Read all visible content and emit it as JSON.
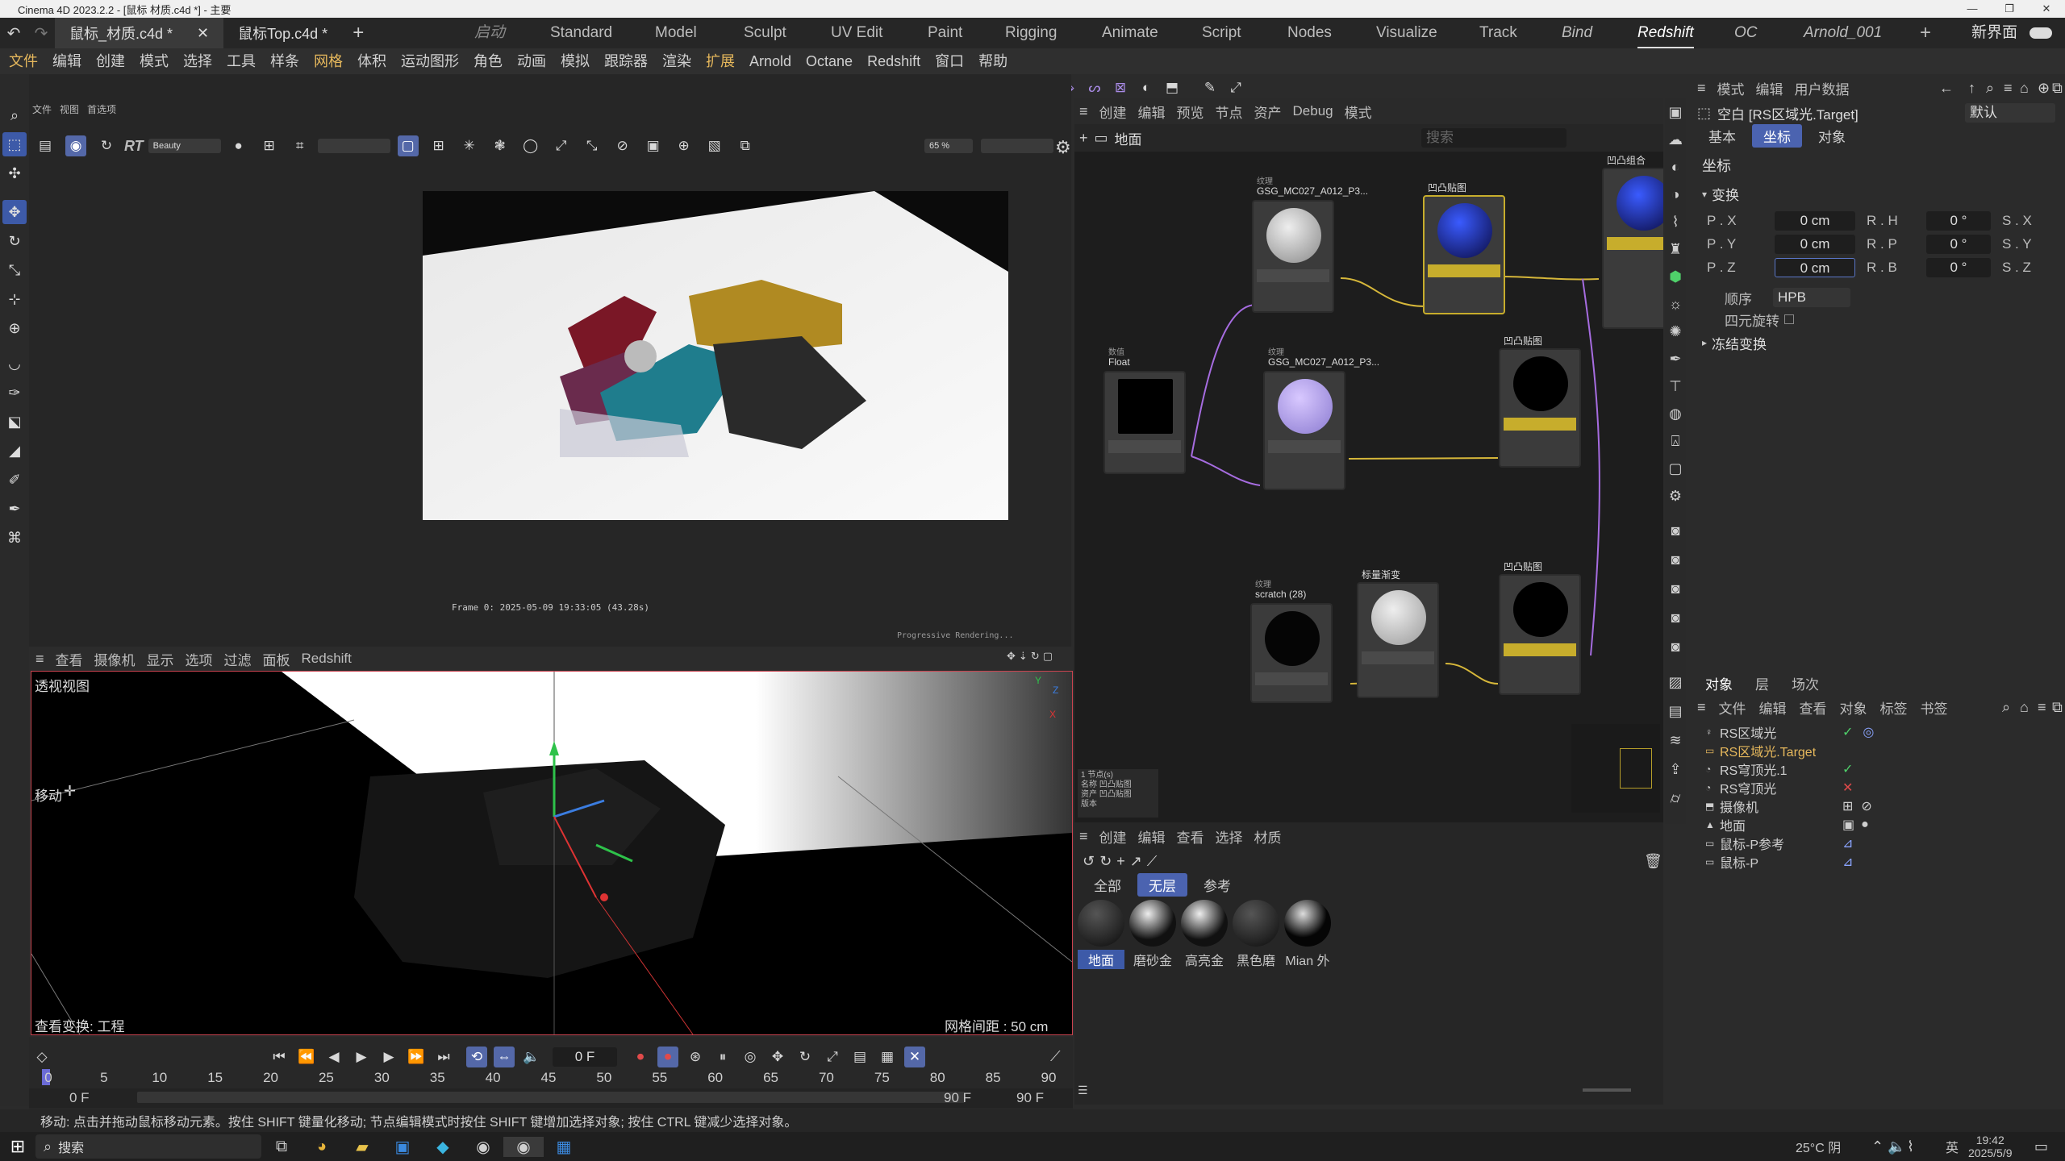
{
  "title": {
    "text": "Cinema 4D 2023.2.2 - [鼠标 材质.c4d *] - 主要"
  },
  "tabs": [
    {
      "label": "鼠标_材质.c4d *"
    },
    {
      "label": "鼠标Top.c4d *"
    }
  ],
  "layouts": [
    "启动",
    "Standard",
    "Model",
    "Sculpt",
    "UV Edit",
    "Paint",
    "Rigging",
    "Animate",
    "Script",
    "Nodes",
    "Visualize",
    "Track",
    "Bind",
    "Redshift",
    "OC",
    "Arnold_001"
  ],
  "new_layout": "新界面",
  "menu": [
    "文件",
    "编辑",
    "创建",
    "模式",
    "选择",
    "工具",
    "样条",
    "网格",
    "体积",
    "运动图形",
    "角色",
    "动画",
    "模拟",
    "跟踪器",
    "渲染",
    "扩展",
    "Arnold",
    "Octane",
    "Redshift",
    "窗口",
    "帮助"
  ],
  "rv": {
    "menu": [
      "文件",
      "视图",
      "首选项"
    ],
    "rt": "RT",
    "aov": "Beauty",
    "zoom": "65 %",
    "frame_info": "Frame  0:  2025-05-09  19:33:05  (43.28s)",
    "progress": "Progressive Rendering..."
  },
  "viewport": {
    "menu": [
      "查看",
      "摄像机",
      "显示",
      "选项",
      "过滤",
      "面板",
      "Redshift"
    ],
    "label": "透视视图",
    "mode": "移动",
    "footer_left": "查看变换: 工程",
    "footer_right": "网格间距 : 50 cm"
  },
  "timeline": {
    "ticks": [
      "0",
      "5",
      "10",
      "15",
      "20",
      "25",
      "30",
      "35",
      "40",
      "45",
      "50",
      "55",
      "60",
      "65",
      "70",
      "75",
      "80",
      "85",
      "90"
    ],
    "current": "0 F",
    "start": "0 F",
    "start2": "0 F",
    "end": "90 F",
    "end2": "90 F"
  },
  "node_editor": {
    "menu": [
      "创建",
      "编辑",
      "预览",
      "节点",
      "资产",
      "Debug",
      "模式"
    ],
    "breadcrumb": "地面",
    "search_placeholder": "搜索",
    "nodes": [
      {
        "sub": "纹理",
        "title": "GSG_MC027_A012_P3..."
      },
      {
        "sub": "",
        "title": "凹凸贴图"
      },
      {
        "sub": "",
        "title": "凹凸组合"
      },
      {
        "sub": "数值",
        "title": "Float"
      },
      {
        "sub": "纹理",
        "title": "GSG_MC027_A012_P3..."
      },
      {
        "sub": "",
        "title": "凹凸贴图"
      },
      {
        "sub": "纹理",
        "title": "scratch (28)"
      },
      {
        "sub": "",
        "title": "标量渐变"
      },
      {
        "sub": "",
        "title": "凹凸贴图"
      }
    ],
    "info": [
      "1 节点(s)",
      "名称  凹凸贴图",
      "资产  凹凸贴图",
      "版本"
    ]
  },
  "materials": {
    "menu": [
      "创建",
      "编辑",
      "查看",
      "选择",
      "材质"
    ],
    "filters": [
      "全部",
      "无层",
      "参考"
    ],
    "items": [
      "地面",
      "磨砂金",
      "高亮金",
      "黑色磨",
      "Mian 外"
    ]
  },
  "attributes": {
    "menu": [
      "模式",
      "编辑",
      "用户数据"
    ],
    "object": "空白 [RS区域光.Target]",
    "preset": "默认",
    "tabs": [
      "基本",
      "坐标",
      "对象"
    ],
    "section": "坐标",
    "group": "变换",
    "rows": [
      {
        "p": "P . X",
        "pv": "0 cm",
        "r": "R . H",
        "rv": "0 °",
        "s": "S . X"
      },
      {
        "p": "P . Y",
        "pv": "0 cm",
        "r": "R . P",
        "rv": "0 °",
        "s": "S . Y"
      },
      {
        "p": "P . Z",
        "pv": "0 cm",
        "r": "R . B",
        "rv": "0 °",
        "s": "S . Z"
      }
    ],
    "order_label": "顺序",
    "order_value": "HPB",
    "quat": "四元旋转",
    "freeze": "冻结变换"
  },
  "objects": {
    "tabs": [
      "对象",
      "层",
      "场次"
    ],
    "menu": [
      "文件",
      "编辑",
      "查看",
      "对象",
      "标签",
      "书签"
    ],
    "items": [
      "RS区域光",
      "RS区域光.Target",
      "RS穹顶光.1",
      "RS穹顶光",
      "摄像机",
      "地面",
      "鼠标-P参考",
      "鼠标-P"
    ]
  },
  "status": "移动: 点击并拖动鼠标移动元素。按住 SHIFT 键量化移动; 节点编辑模式时按住 SHIFT 键增加选择对象; 按住 CTRL 键减少选择对象。",
  "taskbar": {
    "search": "搜索",
    "temp": "25°C 阴",
    "ime": "英",
    "time": "19:42",
    "date": "2025/5/9"
  }
}
